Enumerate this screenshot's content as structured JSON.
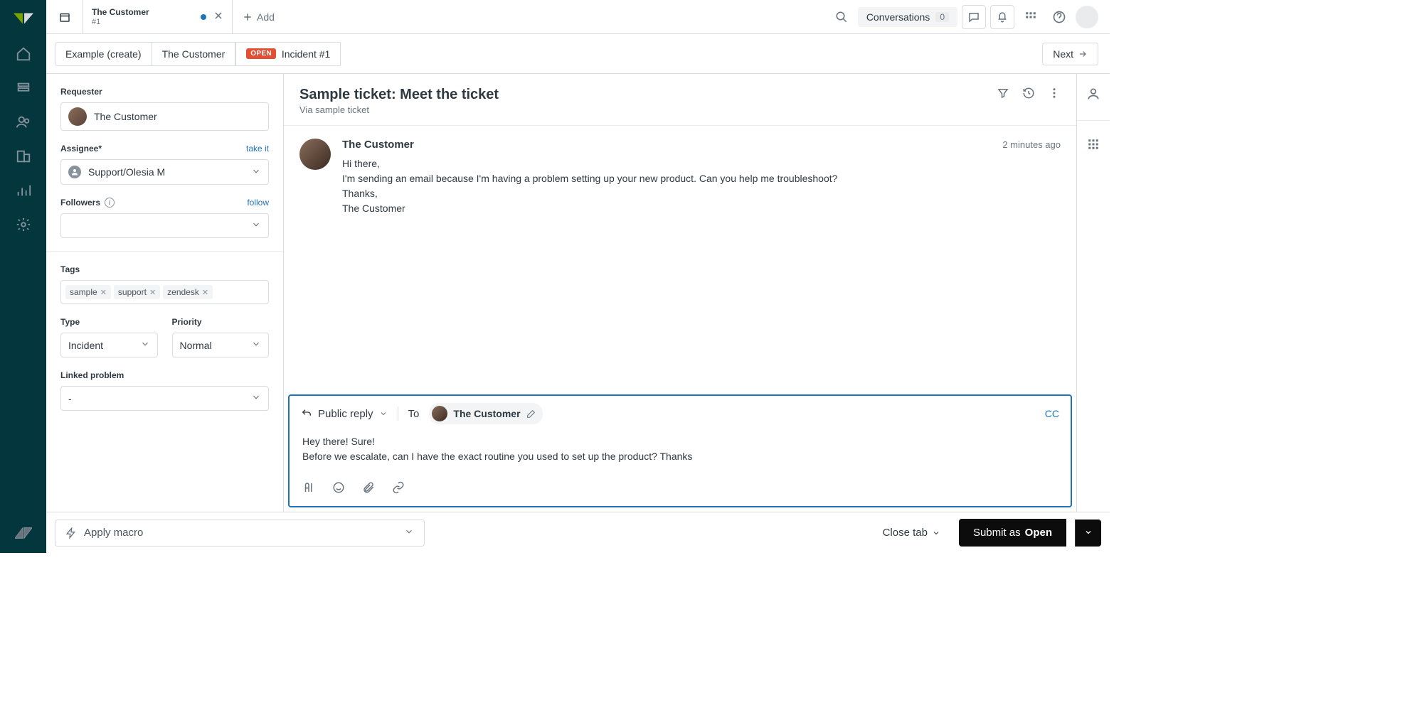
{
  "tab": {
    "title": "The Customer",
    "sub": "#1",
    "add": "Add"
  },
  "top": {
    "conversations": "Conversations",
    "conv_count": "0"
  },
  "breadcrumb": {
    "seg1": "Example (create)",
    "seg2": "The Customer",
    "open": "OPEN",
    "seg3": "Incident #1",
    "next": "Next"
  },
  "side": {
    "requester_label": "Requester",
    "requester_name": "The Customer",
    "assignee_label": "Assignee*",
    "take_it": "take it",
    "assignee_value": "Support/Olesia M",
    "followers_label": "Followers",
    "follow": "follow",
    "tags_label": "Tags",
    "tags": [
      "sample",
      "support",
      "zendesk"
    ],
    "type_label": "Type",
    "type_value": "Incident",
    "priority_label": "Priority",
    "priority_value": "Normal",
    "linked_label": "Linked problem",
    "linked_value": "-"
  },
  "ticket": {
    "title": "Sample ticket: Meet the ticket",
    "via": "Via sample ticket",
    "author": "The Customer",
    "time": "2 minutes ago",
    "body": "Hi there,\nI'm sending an email because I'm having a problem setting up your new product. Can you help me troubleshoot?\nThanks,\nThe Customer"
  },
  "reply": {
    "type": "Public reply",
    "to_label": "To",
    "to_name": "The Customer",
    "cc": "CC",
    "body": "Hey there! Sure!\nBefore we escalate, can I have the exact routine you used to set up the product? Thanks"
  },
  "bottom": {
    "macro": "Apply macro",
    "close_tab": "Close tab",
    "submit_prefix": "Submit as ",
    "submit_status": "Open"
  }
}
